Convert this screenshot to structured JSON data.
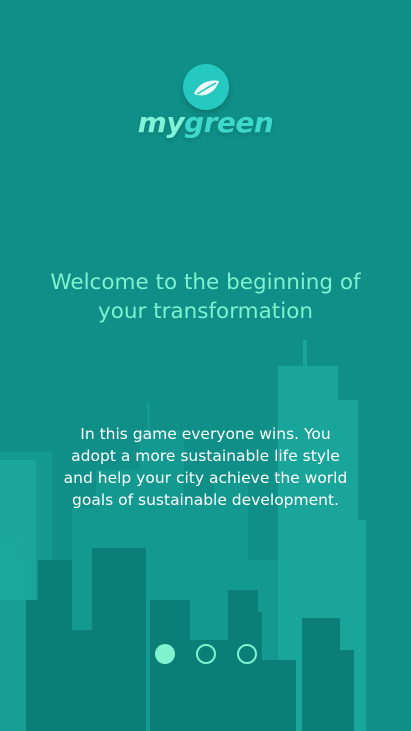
{
  "app": {
    "logo_text_my": "my",
    "logo_text_green": "green",
    "logo_icon": "leaf-icon"
  },
  "onboarding": {
    "headline": "Welcome to the beginning of your transformation",
    "body": "In this game everyone wins. You adopt a more sustainable life style and help your city achieve the world goals of sustainable development.",
    "current_page": 1,
    "total_pages": 3
  },
  "colors": {
    "background": "#0f8f87",
    "accent": "#7ff2cf",
    "logo_badge": "#25c9bf",
    "body_text": "#ffffff",
    "skyline": "#1aa79c"
  }
}
